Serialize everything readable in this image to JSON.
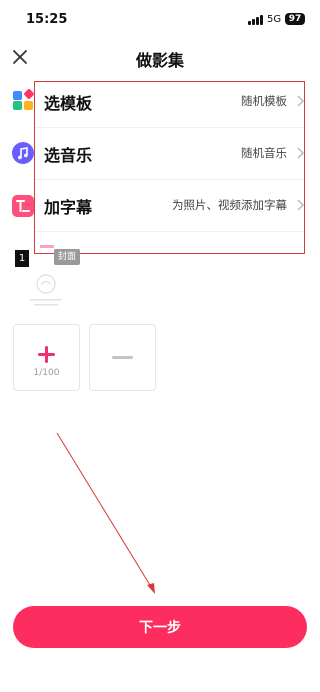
{
  "status_bar": {
    "time": "15:25",
    "network": "5G",
    "battery": "97"
  },
  "nav": {
    "title": "做影集",
    "close_icon": "close-icon"
  },
  "menu": {
    "items": [
      {
        "icon": "template-grid-icon",
        "label": "选模板",
        "value": "随机模板"
      },
      {
        "icon": "music-note-icon",
        "label": "选音乐",
        "value": "随机音乐"
      },
      {
        "icon": "subtitle-icon",
        "label": "加字幕",
        "value": "为照片、视频添加字幕"
      }
    ]
  },
  "media": {
    "thumb_number": "1",
    "cover_badge": "封面"
  },
  "tiles": {
    "add_count": "1/100"
  },
  "footer": {
    "next_label": "下一步"
  },
  "colors": {
    "accent": "#fe2d5f",
    "plus": "#f0306a",
    "annotation": "#d63a3a"
  }
}
